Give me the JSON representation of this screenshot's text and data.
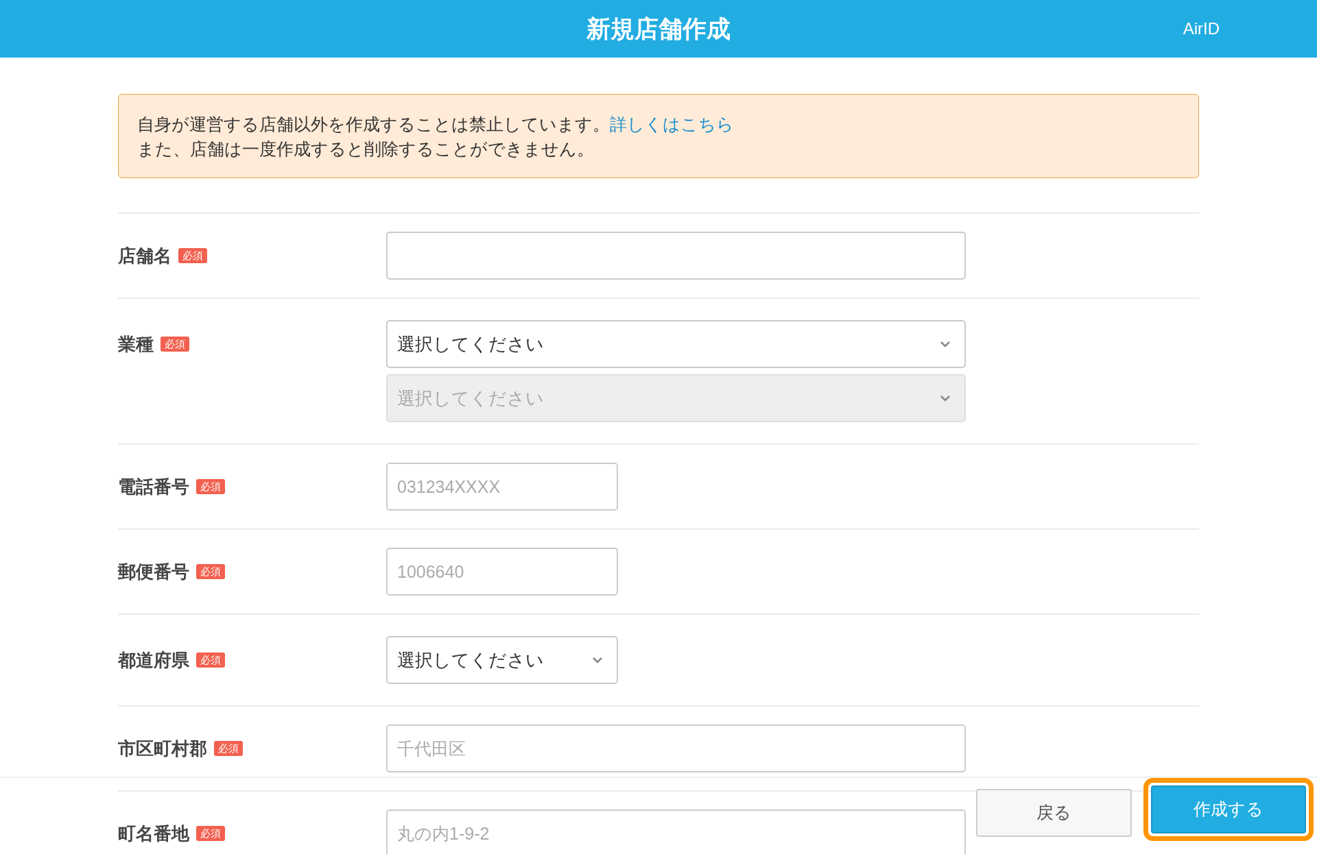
{
  "header": {
    "title": "新規店舗作成",
    "account": "AirID"
  },
  "notice": {
    "line_1": "自身が運営する店舗以外を作成することは禁止しています。",
    "link": "詳しくはこちら",
    "line_2": "また、店舗は一度作成すると削除することができません。"
  },
  "fields": [
    {
      "label": "店舗名",
      "badge": "必須",
      "kind": "text"
    },
    {
      "label": "業種",
      "badge": "必須",
      "kind": "selects",
      "selects": [
        {
          "value": "選択してください",
          "disabled": false
        },
        {
          "value": "選択してください",
          "disabled": true
        }
      ]
    },
    {
      "label": "電話番号",
      "badge": "必須",
      "kind": "text",
      "placeholder": "031234XXXX"
    },
    {
      "label": "郵便番号",
      "badge": "必須",
      "kind": "text",
      "placeholder": "1006640"
    },
    {
      "label": "都道府県",
      "badge": "必須",
      "kind": "selects",
      "selects": [
        {
          "value": "選択してください",
          "disabled": false
        }
      ]
    },
    {
      "label": "市区町村郡",
      "badge": "必須",
      "kind": "text",
      "placeholder": "千代田区"
    },
    {
      "label": "町名番地",
      "badge": "必須",
      "kind": "text",
      "placeholder": "丸の内1-9-2"
    }
  ],
  "footer": {
    "buttons": [
      {
        "label": "戻る",
        "kind": "secondary",
        "highlighted": false
      },
      {
        "label": "作成する",
        "kind": "primary",
        "highlighted": true
      }
    ]
  }
}
